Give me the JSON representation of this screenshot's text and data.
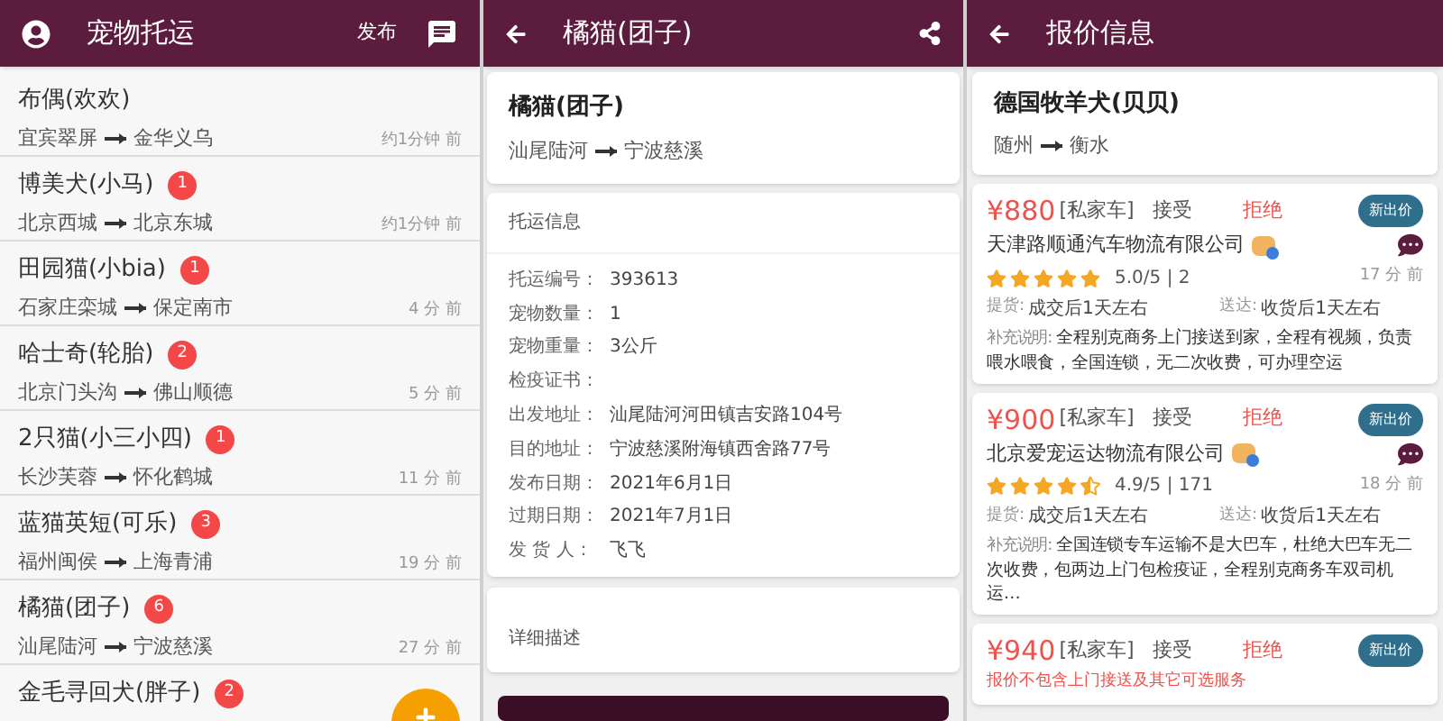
{
  "list_screen": {
    "title": "宠物托运",
    "publish": "发布",
    "items": [
      {
        "name": "布偶(欢欢)",
        "from": "宜宾翠屏",
        "to": "金华义乌",
        "time": "约1分钟 前"
      },
      {
        "name": "博美犬(小马)",
        "badge": "1",
        "from": "北京西城",
        "to": "北京东城",
        "time": "约1分钟 前"
      },
      {
        "name": "田园猫(小bia)",
        "badge": "1",
        "from": "石家庄栾城",
        "to": "保定南市",
        "time": "4 分 前"
      },
      {
        "name": "哈士奇(轮胎)",
        "badge": "2",
        "from": "北京门头沟",
        "to": "佛山顺德",
        "time": "5 分 前"
      },
      {
        "name": "2只猫(小三小四)",
        "badge": "1",
        "from": "长沙芙蓉",
        "to": "怀化鹤城",
        "time": "11 分 前"
      },
      {
        "name": "蓝猫英短(可乐)",
        "badge": "3",
        "from": "福州闽侯",
        "to": "上海青浦",
        "time": "19 分 前"
      },
      {
        "name": "橘猫(团子)",
        "badge": "6",
        "from": "汕尾陆河",
        "to": "宁波慈溪",
        "time": "27 分 前"
      },
      {
        "name": "金毛寻回犬(胖子)",
        "badge": "2"
      }
    ]
  },
  "detail_screen": {
    "title": "橘猫(团子)",
    "pet": "橘猫(团子)",
    "from": "汕尾陆河",
    "to": "宁波慈溪",
    "info_title": "托运信息",
    "fields": [
      {
        "label": "托运编号：",
        "value": "393613"
      },
      {
        "label": "宠物数量：",
        "value": "1"
      },
      {
        "label": "宠物重量：",
        "value": "3公斤"
      },
      {
        "label": "检疫证书："
      },
      {
        "label": "出发地址：",
        "value": "汕尾陆河河田镇吉安路104号"
      },
      {
        "label": "目的地址：",
        "value": "宁波慈溪附海镇西舍路77号"
      },
      {
        "label": "发布日期：",
        "value": "2021年6月1日"
      },
      {
        "label": "过期日期：",
        "value": "2021年7月1日"
      },
      {
        "label": "发 货 人：",
        "value": "飞飞"
      }
    ],
    "description_title": "详细描述"
  },
  "quote_screen": {
    "title": "报价信息",
    "pet": "德国牧羊犬(贝贝)",
    "from": "随州",
    "to": "衡水",
    "offers": [
      {
        "price": "¥880",
        "vehicle": "[私家车]",
        "accept": "接受",
        "reject": "拒绝",
        "new_offer": "新出价",
        "company": "天津路顺通汽车物流有限公司",
        "stars": 5,
        "rating": "5.0/5 | 2",
        "time": "17 分 前",
        "pickup_label": "提货:",
        "pickup": "成交后1天左右",
        "delivery_label": "送达:",
        "delivery": "收货后1天左右",
        "remark_label": "补充说明:",
        "remark": "全程别克商务上门接送到家，全程有视频，负责喂水喂食，全国连锁，无二次收费，可办理空运"
      },
      {
        "price": "¥900",
        "vehicle": "[私家车]",
        "accept": "接受",
        "reject": "拒绝",
        "new_offer": "新出价",
        "company": "北京爱宠运达物流有限公司",
        "stars": 4.5,
        "rating": "4.9/5 | 171",
        "time": "18 分 前",
        "pickup_label": "提货:",
        "pickup": "成交后1天左右",
        "delivery_label": "送达:",
        "delivery": "收货后1天左右",
        "remark_label": "补充说明:",
        "remark": "全国连锁专车运输不是大巴车，杜绝大巴车无二次收费，包两边上门包检疫证，全程别克商务车双司机运…"
      },
      {
        "price": "¥940",
        "vehicle": "[私家车]",
        "accept": "接受",
        "reject": "拒绝",
        "new_offer": "新出价",
        "note": "报价不包含上门接送及其它可选服务"
      }
    ]
  }
}
